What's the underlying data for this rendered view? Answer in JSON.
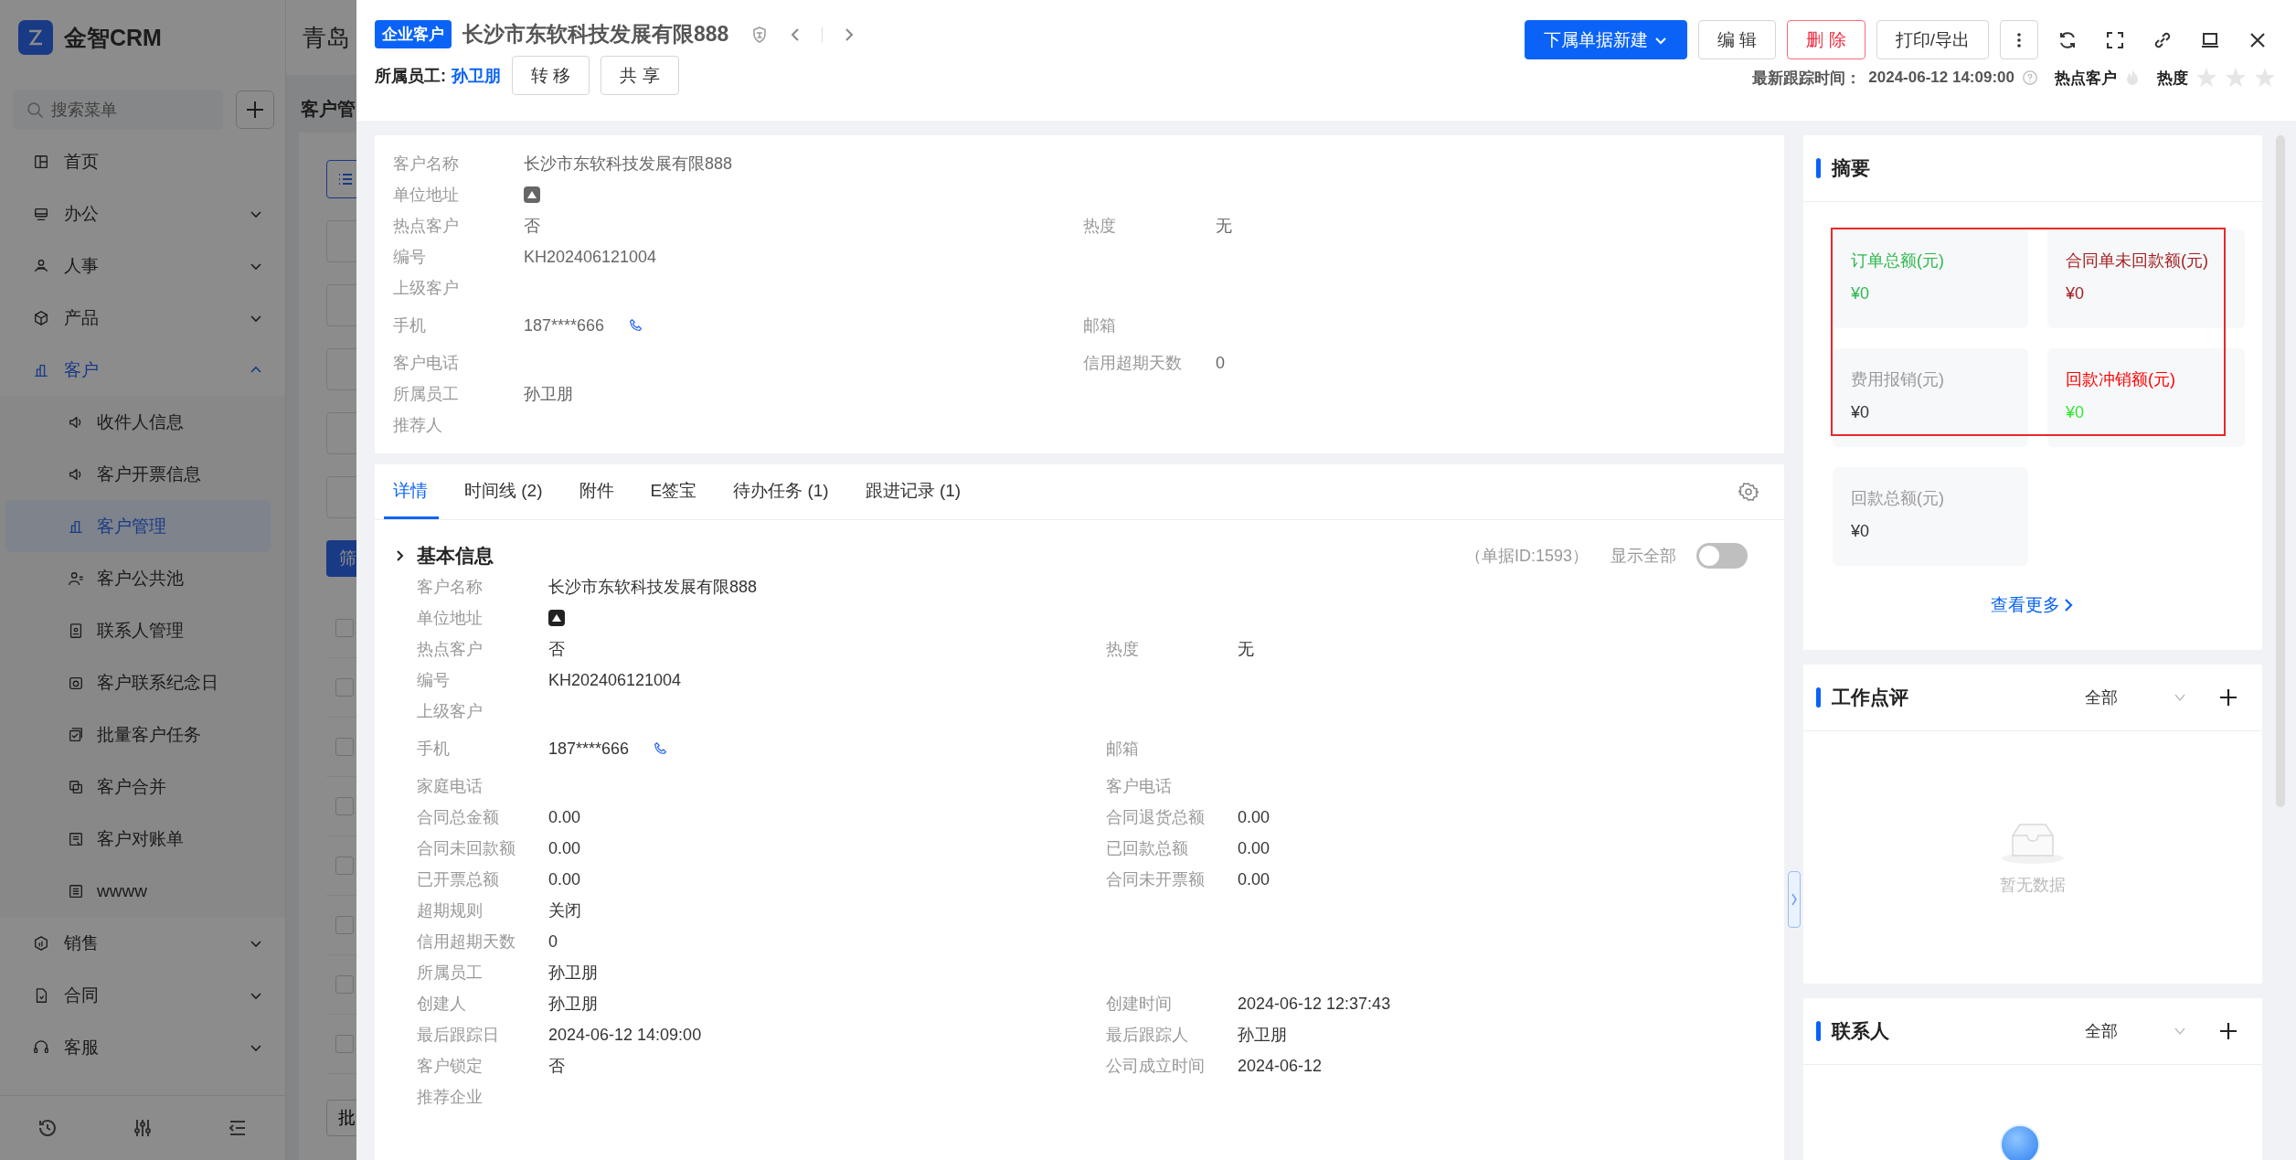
{
  "sidebar": {
    "logo": "金智CRM",
    "search": {
      "placeholder": "搜索菜单"
    },
    "items": [
      {
        "label": "首页",
        "kind": "link",
        "selected": false
      },
      {
        "label": "办公",
        "kind": "group",
        "selected": false,
        "expanded": false
      },
      {
        "label": "人事",
        "kind": "group",
        "selected": false,
        "expanded": false
      },
      {
        "label": "产品",
        "kind": "group",
        "selected": false,
        "expanded": false
      },
      {
        "label": "客户",
        "kind": "group",
        "selected": true,
        "expanded": true,
        "children": [
          {
            "label": "收件人信息",
            "selected": false
          },
          {
            "label": "客户开票信息",
            "selected": false
          },
          {
            "label": "客户管理",
            "selected": true
          },
          {
            "label": "客户公共池",
            "selected": false
          },
          {
            "label": "联系人管理",
            "selected": false
          },
          {
            "label": "客户联系纪念日",
            "selected": false
          },
          {
            "label": "批量客户任务",
            "selected": false
          },
          {
            "label": "客户合并",
            "selected": false
          },
          {
            "label": "客户对账单",
            "selected": false
          },
          {
            "label": "wwww",
            "selected": false
          }
        ]
      },
      {
        "label": "销售",
        "kind": "group",
        "selected": false,
        "expanded": false
      },
      {
        "label": "合同",
        "kind": "group",
        "selected": false,
        "expanded": false
      },
      {
        "label": "客服",
        "kind": "group",
        "selected": false,
        "expanded": false
      }
    ]
  },
  "background": {
    "title": "青岛",
    "page_tab": "客户管",
    "filter_button": "筛",
    "batch_button": "批",
    "rows": [
      {
        "checked": false
      },
      {
        "checked": false
      },
      {
        "checked": false
      },
      {
        "checked": false
      },
      {
        "checked": false
      },
      {
        "checked": false
      },
      {
        "checked": false
      },
      {
        "checked": false
      }
    ]
  },
  "header": {
    "tag": "企业客户",
    "title": "长沙市东软科技发展有限888",
    "owner_label": "所属员工:",
    "owner": "孙卫朋",
    "owner_actions": [
      "转 移",
      "共 享"
    ],
    "actions": [
      {
        "label": "下属单据新建",
        "kind": "primary"
      },
      {
        "label": "编 辑",
        "kind": "default"
      },
      {
        "label": "删 除",
        "kind": "danger"
      },
      {
        "label": "打印/导出",
        "kind": "default"
      }
    ],
    "last_track_label": "最新跟踪时间：",
    "last_track": "2024-06-12 14:09:00",
    "hot_label": "热点客户",
    "hot": false,
    "heat_label": "热度",
    "stars": 0
  },
  "profile": {
    "rows": [
      {
        "left": {
          "label": "客户名称",
          "value": "长沙市东软科技发展有限888",
          "kind": "text"
        }
      },
      {
        "left": {
          "label": "单位地址",
          "kind": "location"
        }
      },
      {
        "left": {
          "label": "热点客户",
          "value": "否",
          "kind": "text"
        },
        "right": {
          "label": "热度",
          "value": "无",
          "kind": "text"
        }
      },
      {
        "left": {
          "label": "编号",
          "value": "KH202406121004",
          "kind": "text"
        }
      },
      {
        "left": {
          "label": "上级客户",
          "kind": "text"
        }
      },
      {
        "left": {
          "label": "手机",
          "value": "187****666",
          "kind": "phone"
        },
        "right": {
          "label": "邮箱",
          "kind": "text"
        }
      },
      {
        "left": {
          "label": "客户电话",
          "kind": "text"
        },
        "right": {
          "label": "信用超期天数",
          "value": "0",
          "kind": "text"
        }
      },
      {
        "left": {
          "label": "所属员工",
          "value": "孙卫朋",
          "kind": "text"
        }
      },
      {
        "left": {
          "label": "推荐人",
          "kind": "text"
        }
      }
    ]
  },
  "tabs": [
    {
      "label": "详情",
      "selected": true
    },
    {
      "label": "时间线 (2)",
      "selected": false
    },
    {
      "label": "附件",
      "selected": false
    },
    {
      "label": "E签宝",
      "selected": false
    },
    {
      "label": "待办任务 (1)",
      "selected": false
    },
    {
      "label": "跟进记录 (1)",
      "selected": false
    }
  ],
  "section": {
    "title": "基本信息",
    "doc_id": "（单据ID:1593）",
    "show_all_label": "显示全部",
    "show_all": false,
    "rows": [
      {
        "left": {
          "label": "客户名称",
          "value": "长沙市东软科技发展有限888",
          "kind": "text"
        }
      },
      {
        "left": {
          "label": "单位地址",
          "kind": "location"
        }
      },
      {
        "left": {
          "label": "热点客户",
          "value": "否",
          "kind": "text"
        },
        "right": {
          "label": "热度",
          "value": "无",
          "kind": "text"
        }
      },
      {
        "left": {
          "label": "编号",
          "value": "KH202406121004",
          "kind": "text"
        }
      },
      {
        "left": {
          "label": "上级客户",
          "kind": "text"
        }
      },
      {
        "left": {
          "label": "手机",
          "value": "187****666",
          "kind": "phone"
        },
        "right": {
          "label": "邮箱",
          "kind": "text"
        }
      },
      {
        "left": {
          "label": "家庭电话",
          "kind": "text"
        },
        "right": {
          "label": "客户电话",
          "kind": "text"
        }
      },
      {
        "left": {
          "label": "合同总金额",
          "value": "0.00",
          "kind": "text"
        },
        "right": {
          "label": "合同退货总额",
          "value": "0.00",
          "kind": "text"
        }
      },
      {
        "left": {
          "label": "合同未回款额",
          "value": "0.00",
          "kind": "text"
        },
        "right": {
          "label": "已回款总额",
          "value": "0.00",
          "kind": "text"
        }
      },
      {
        "left": {
          "label": "已开票总额",
          "value": "0.00",
          "kind": "text"
        },
        "right": {
          "label": "合同未开票额",
          "value": "0.00",
          "kind": "text"
        }
      },
      {
        "left": {
          "label": "超期规则",
          "value": "关闭",
          "kind": "text"
        }
      },
      {
        "left": {
          "label": "信用超期天数",
          "value": "0",
          "kind": "text"
        }
      },
      {
        "left": {
          "label": "所属员工",
          "value": "孙卫朋",
          "kind": "text"
        }
      },
      {
        "left": {
          "label": "创建人",
          "value": "孙卫朋",
          "kind": "text"
        },
        "right": {
          "label": "创建时间",
          "value": "2024-06-12 12:37:43",
          "kind": "text"
        }
      },
      {
        "left": {
          "label": "最后跟踪日",
          "value": "2024-06-12 14:09:00",
          "kind": "text"
        },
        "right": {
          "label": "最后跟踪人",
          "value": "孙卫朋",
          "kind": "text"
        }
      },
      {
        "left": {
          "label": "客户锁定",
          "value": "否",
          "kind": "text"
        },
        "right": {
          "label": "公司成立时间",
          "value": "2024-06-12",
          "kind": "text"
        }
      },
      {
        "left": {
          "label": "推荐企业",
          "kind": "text"
        }
      }
    ]
  },
  "summary": {
    "title": "摘要",
    "stats": [
      {
        "label": {
          "text": "订单总额(元)",
          "color": "#2db84d"
        },
        "value": {
          "text": "¥0",
          "color": "#2db84d"
        }
      },
      {
        "label": {
          "text": "合同单未回款额(元)",
          "color": "#a31f1f"
        },
        "value": {
          "text": "¥0",
          "color": "#a31f1f"
        }
      },
      {
        "label": {
          "text": "费用报销(元)",
          "color": "#999999"
        },
        "value": {
          "text": "¥0",
          "color": "#333333"
        }
      },
      {
        "label": {
          "text": "回款冲销额(元)",
          "color": "#ff0000"
        },
        "value": {
          "text": "¥0",
          "color": "#33e633"
        }
      },
      {
        "label": {
          "text": "回款总额(元)",
          "color": "#999999"
        },
        "value": {
          "text": "¥0",
          "color": "#333333"
        }
      }
    ],
    "more": "查看更多"
  },
  "review": {
    "title": "工作点评",
    "filter": "全部",
    "empty": "暂无数据"
  },
  "contacts": {
    "title": "联系人",
    "filter": "全部"
  }
}
